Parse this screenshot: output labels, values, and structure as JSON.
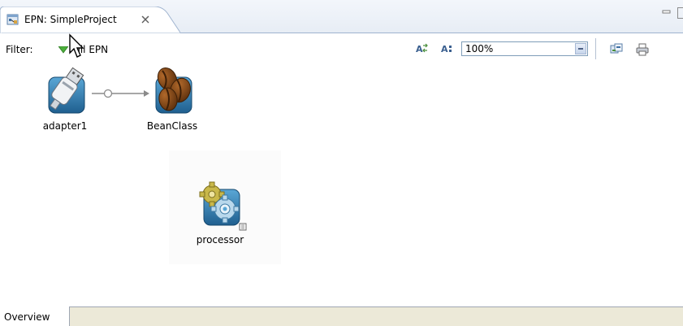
{
  "editor_tab": {
    "title": "EPN: SimpleProject"
  },
  "toolbar": {
    "filter_label": "Filter:",
    "filter_value": "Full EPN",
    "zoom_value": "100%"
  },
  "nodes": [
    {
      "label": "adapter1",
      "icon": "adapter-usb-icon"
    },
    {
      "label": "BeanClass",
      "icon": "coffee-bean-icon"
    },
    {
      "label": "processor",
      "icon": "processor-gear-icon"
    }
  ],
  "bottom_tabs": {
    "overview": "Overview"
  },
  "colors": {
    "tab_strip": "#e7edf5",
    "tab_border": "#9fb3cf",
    "icon_blue": "#2f7fb5",
    "bean_brown": "#7a4418",
    "bottom_bar": "#ece9d8"
  }
}
